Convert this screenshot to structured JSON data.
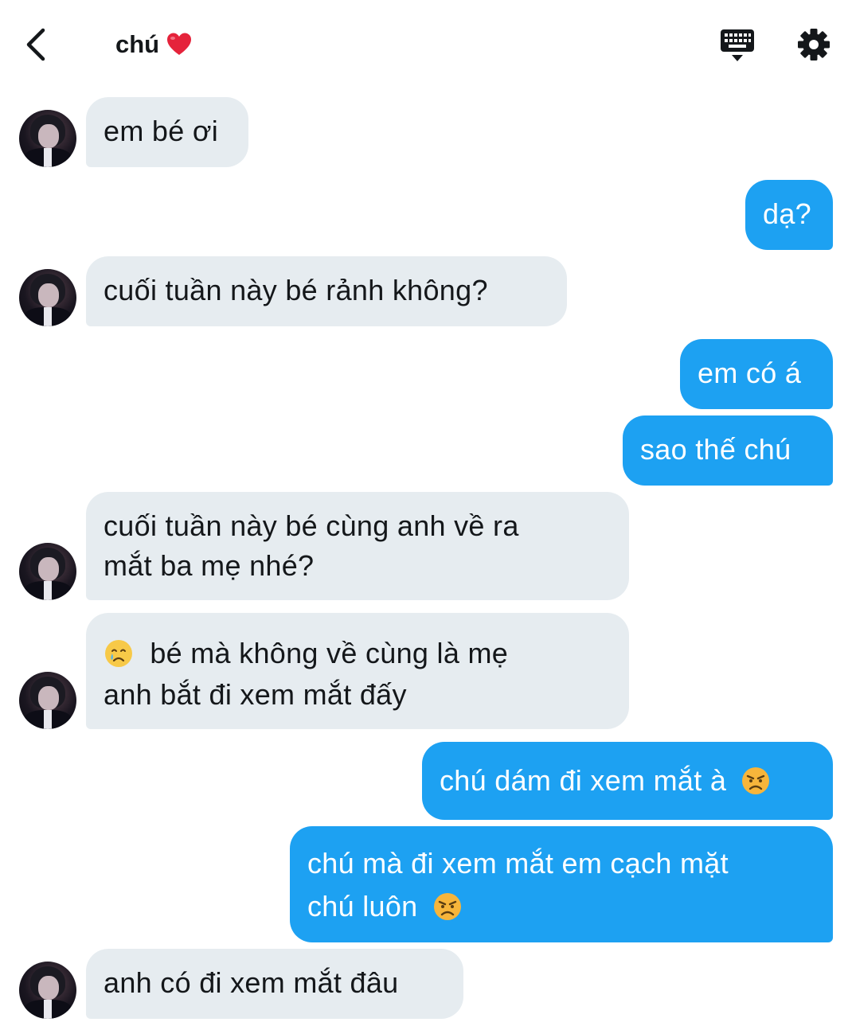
{
  "header": {
    "contact_name": "chú",
    "icons": {
      "back": "chevron-left-icon",
      "heart": "red-heart-icon",
      "keyboard": "keyboard-icon",
      "settings": "gear-icon"
    }
  },
  "colors": {
    "incoming_bubble": "#e6ecf0",
    "outgoing_bubble": "#1da1f2",
    "text": "#14171a"
  },
  "messages": [
    {
      "side": "in",
      "text": "em bé ơi"
    },
    {
      "side": "out",
      "text": "dạ?"
    },
    {
      "side": "in",
      "text": "cuối tuần này bé rảnh không?"
    },
    {
      "side": "out",
      "text": "em có á"
    },
    {
      "side": "out",
      "text": "sao thế chú"
    },
    {
      "side": "in",
      "line1": "cuối tuần này bé cùng anh về ra",
      "line2": "mắt ba mẹ nhé?"
    },
    {
      "side": "in",
      "emoji": "crying-face-emoji",
      "line1": "bé mà không về cùng là mẹ",
      "line2": "anh bắt đi xem mắt đấy"
    },
    {
      "side": "out",
      "text": "chú dám đi xem mắt à",
      "emoji": "angry-face-emoji"
    },
    {
      "side": "out",
      "line1": "chú mà đi xem mắt em cạch mặt",
      "line2": "chú luôn",
      "emoji": "angry-face-emoji"
    },
    {
      "side": "in",
      "text": "anh có đi xem mắt đâu"
    }
  ]
}
